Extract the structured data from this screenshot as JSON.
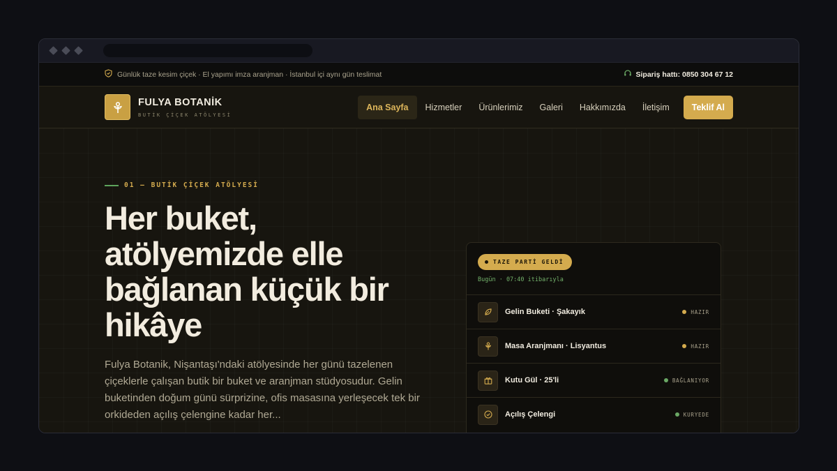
{
  "topbar": {
    "notice": "Günlük taze kesim çiçek · El yapımı imza aranjman · İstanbul içi aynı gün teslimat",
    "phone": "Sipariş hattı: 0850 304 67 12"
  },
  "brand": {
    "name": "FULYA BOTANİK",
    "tagline": "BUTİK ÇİÇEK ATÖLYESİ"
  },
  "nav": {
    "items": [
      "Ana Sayfa",
      "Hizmetler",
      "Ürünlerimiz",
      "Galeri",
      "Hakkımızda",
      "İletişim"
    ],
    "active": "Ana Sayfa",
    "cta": "Teklif Al"
  },
  "hero": {
    "eyebrow": "01 — BUTİK ÇİÇEK ATÖLYESİ",
    "headline": "Her buket, atölyemizde elle bağlanan küçük bir hikâye",
    "lead": "Fulya Botanik, Nişantaşı'ndaki atölyesinde her günü tazelenen çiçeklerle çalışan butik bir buket ve aranjman stüdyosudur. Gelin buketinden doğum günü sürprizine, ofis masasına yerleşecek tek bir orkideden açılış çelengine kadar her..."
  },
  "card": {
    "badge": "TAZE PARTİ GELDİ",
    "subtitle": "Bugün · 07:40 itibarıyla",
    "orders": [
      {
        "name": "Gelin Buketi · Şakayık",
        "status": "HAZIR",
        "color": "#d4ab4e",
        "icon": "leaf-icon"
      },
      {
        "name": "Masa Aranjmanı · Lisyantus",
        "status": "HAZIR",
        "color": "#d4ab4e",
        "icon": "flower-icon"
      },
      {
        "name": "Kutu Gül · 25'li",
        "status": "BAĞLANIYOR",
        "color": "#6aa865",
        "icon": "gift-icon"
      },
      {
        "name": "Açılış Çelengi",
        "status": "KURYEDE",
        "color": "#6aa865",
        "icon": "check-circle-icon"
      }
    ]
  },
  "colors": {
    "accent": "#d4ab4e",
    "green": "#6aa865",
    "background": "#17150f"
  }
}
